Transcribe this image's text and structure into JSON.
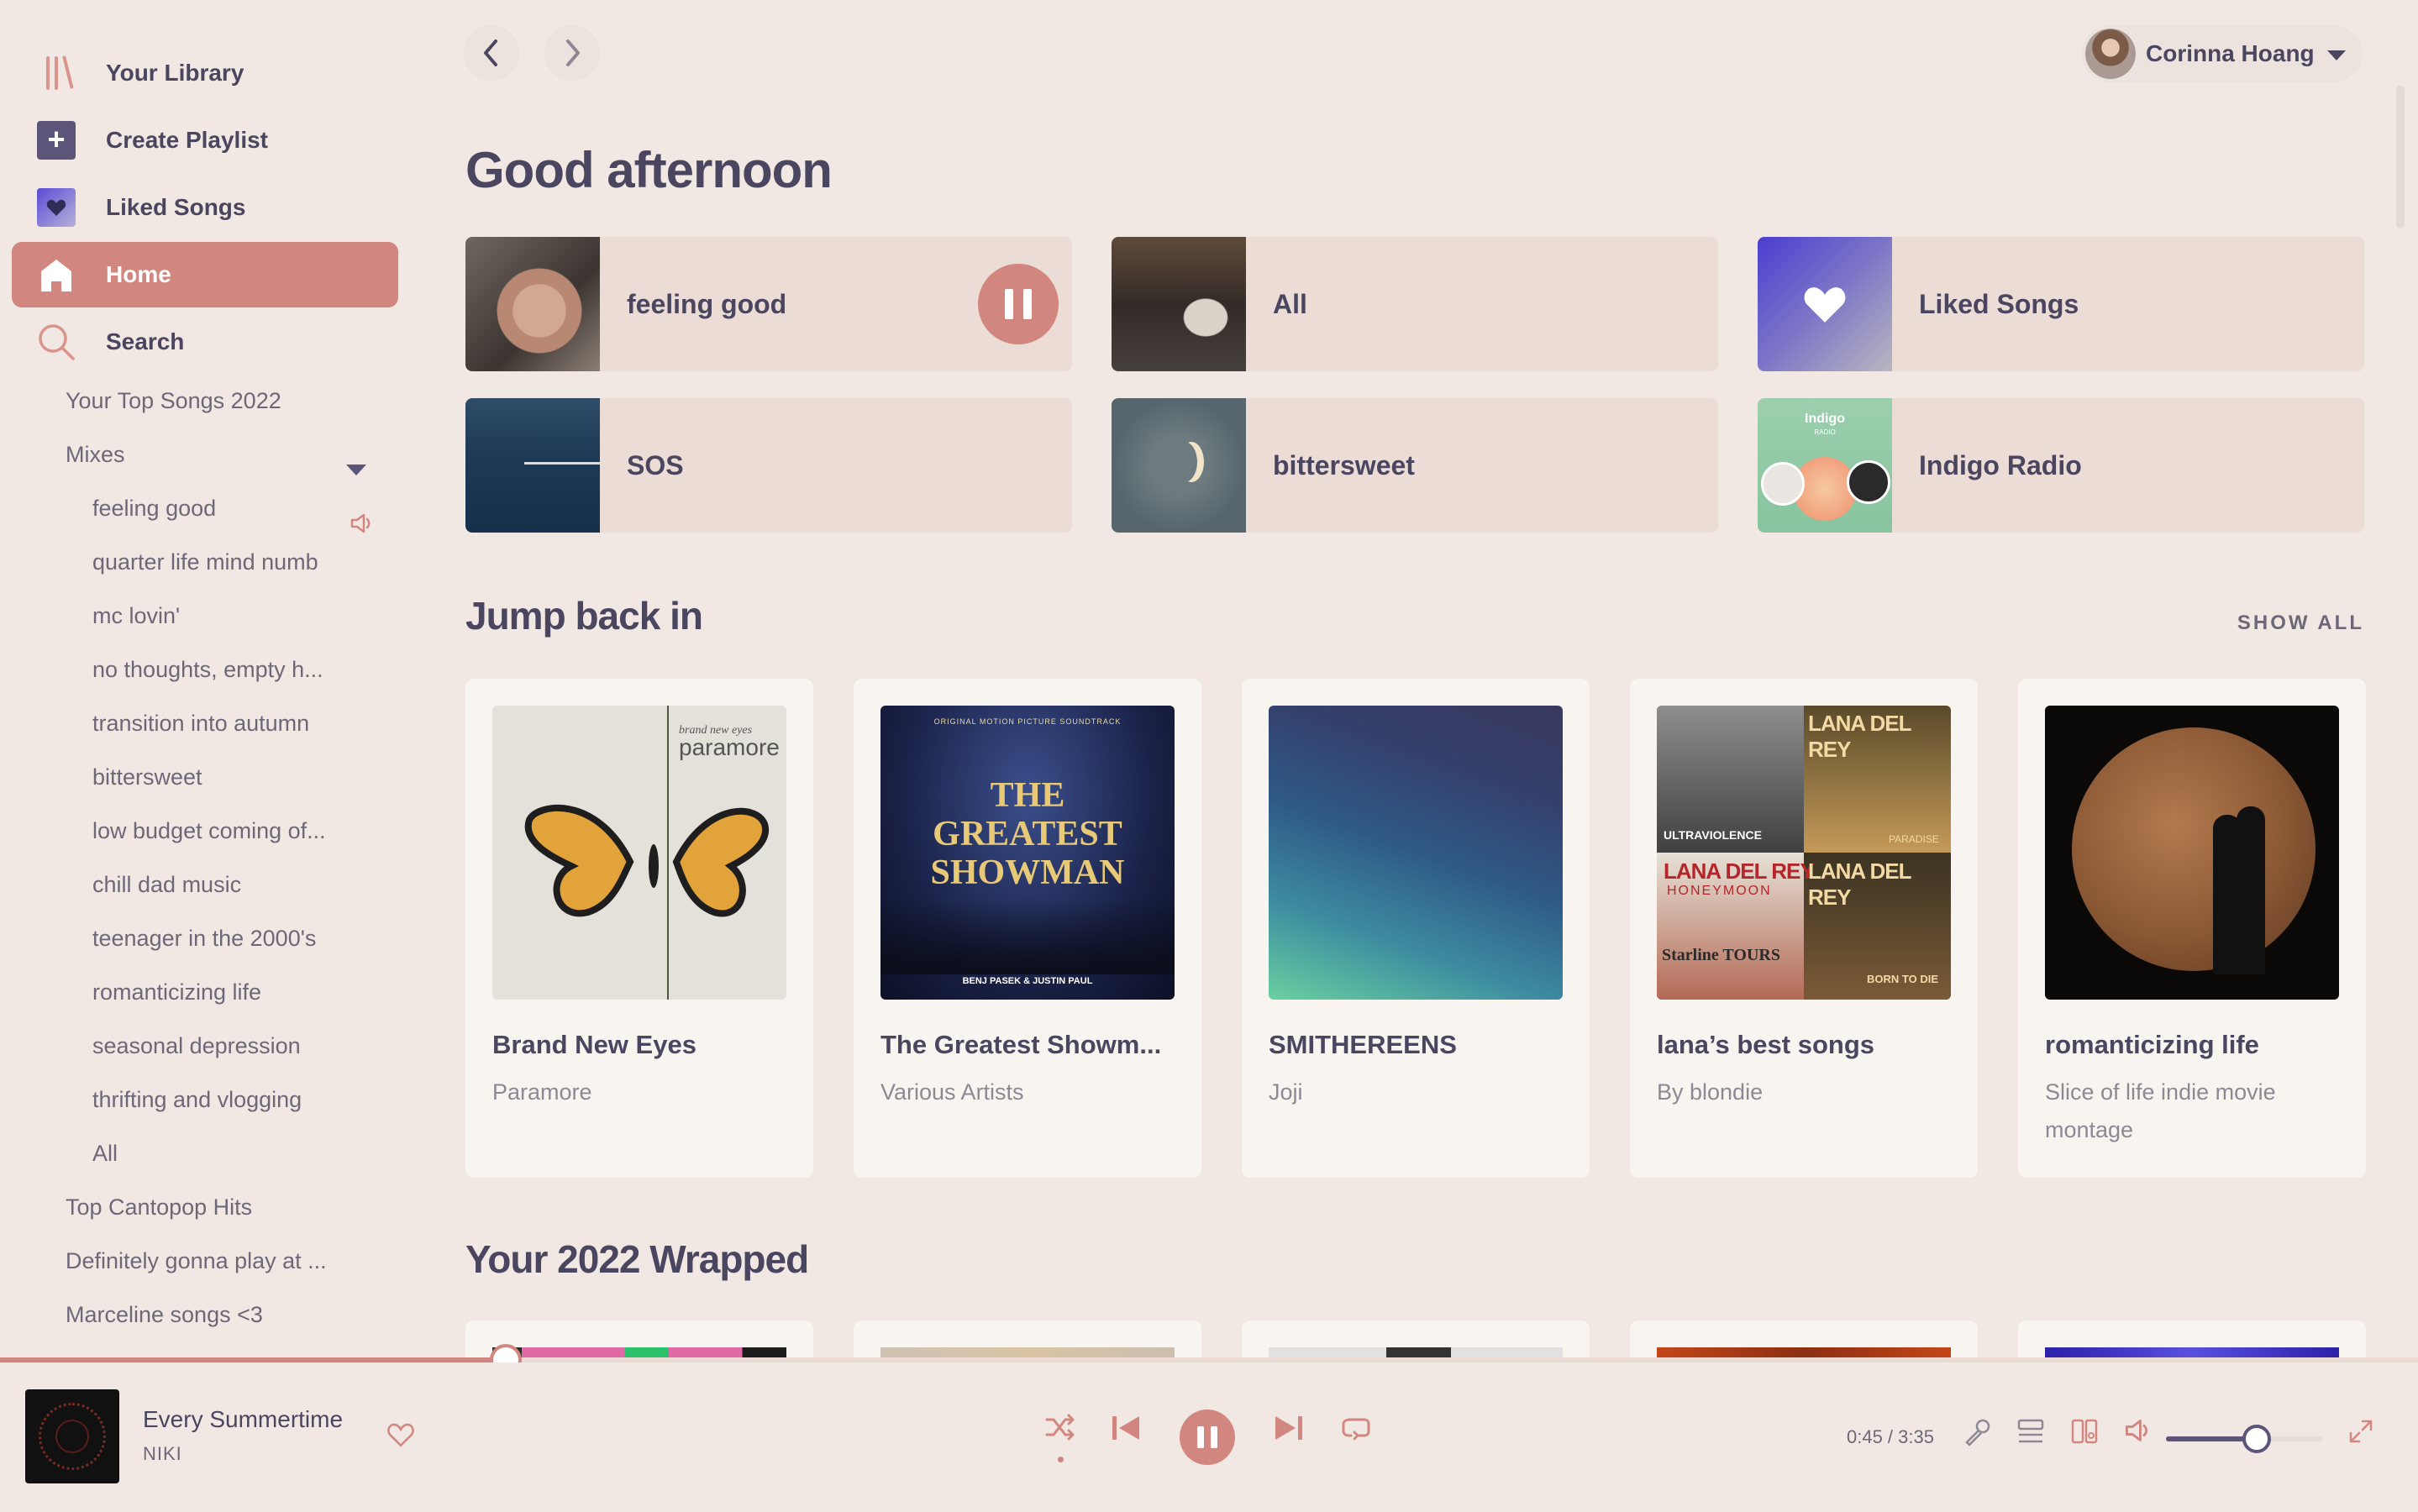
{
  "sidebar": {
    "nav": [
      {
        "label": "Your Library",
        "icon": "library-icon"
      },
      {
        "label": "Create Playlist",
        "icon": "plus-icon"
      },
      {
        "label": "Liked Songs",
        "icon": "heart-icon"
      },
      {
        "label": "Home",
        "icon": "home-icon",
        "active": true
      },
      {
        "label": "Search",
        "icon": "search-icon"
      }
    ],
    "playlists": [
      {
        "label": "Your Top Songs 2022",
        "level": 1
      },
      {
        "label": "Mixes",
        "level": 1,
        "expanded": true
      },
      {
        "label": "feeling good",
        "level": 2,
        "playing": true
      },
      {
        "label": "quarter life mind numb",
        "level": 2
      },
      {
        "label": "mc lovin'",
        "level": 2
      },
      {
        "label": "no thoughts, empty h...",
        "level": 2
      },
      {
        "label": "transition into autumn",
        "level": 2
      },
      {
        "label": "bittersweet",
        "level": 2
      },
      {
        "label": "low budget coming of...",
        "level": 2
      },
      {
        "label": "chill dad music",
        "level": 2
      },
      {
        "label": "teenager in the 2000's",
        "level": 2
      },
      {
        "label": "romanticizing life",
        "level": 2
      },
      {
        "label": "seasonal depression",
        "level": 2
      },
      {
        "label": "thrifting and vlogging",
        "level": 2
      },
      {
        "label": "All",
        "level": 2
      },
      {
        "label": "Top Cantopop Hits",
        "level": 1
      },
      {
        "label": "Definitely gonna play at ...",
        "level": 1
      },
      {
        "label": "Marceline songs <3",
        "level": 1
      }
    ]
  },
  "topbar": {
    "back_icon": "chevron-left-icon",
    "forward_icon": "chevron-right-icon",
    "user_name": "Corinna Hoang"
  },
  "main": {
    "greeting": "Good afternoon",
    "quick_picks": [
      {
        "title": "feeling good",
        "playing": true
      },
      {
        "title": "All"
      },
      {
        "title": "Liked Songs"
      },
      {
        "title": "SOS"
      },
      {
        "title": "bittersweet"
      },
      {
        "title": "Indigo Radio",
        "art_text": "Indigo",
        "art_subtext": "RADIO"
      }
    ],
    "jump_back_in": {
      "title": "Jump back in",
      "show_all": "SHOW ALL",
      "cards": [
        {
          "title": "Brand New Eyes",
          "subtitle": "Paramore",
          "art_text": "paramore",
          "art_subtext": "brand new eyes"
        },
        {
          "title": "The Greatest Showm...",
          "subtitle": "Various Artists",
          "art_text": "THE GREATEST SHOWMAN",
          "art_subtext": "ORIGINAL MOTION PICTURE SOUNDTRACK",
          "art_footer": "BENJ PASEK & JUSTIN PAUL"
        },
        {
          "title": "SMITHEREENS",
          "subtitle": "Joji"
        },
        {
          "title": "lana’s best songs",
          "subtitle": "By blondie",
          "art_text_a": "LANA DEL REY",
          "art_text_b": "ULTRAVIOLENCE",
          "art_text_c": "HONEYMOON",
          "art_text_d": "PARADISE",
          "art_text_e": "BORN TO DIE",
          "art_text_f": "Starline TOURS"
        },
        {
          "title": "romanticizing life",
          "subtitle": "Slice of life indie movie montage"
        }
      ]
    },
    "wrapped": {
      "title": "Your 2022 Wrapped"
    }
  },
  "player": {
    "track_title": "Every Summertime",
    "artist": "NIKI",
    "elapsed": "0:45",
    "duration": "3:35",
    "time_display": "0:45 / 3:35",
    "progress_fraction": 0.2093,
    "volume_fraction": 0.58,
    "shuffle": true
  },
  "colors": {
    "accent": "#d1877f",
    "text": "#4a4660",
    "background": "#f2e8e3",
    "tile": "#ecdcd6",
    "card": "#f8f4f0"
  }
}
